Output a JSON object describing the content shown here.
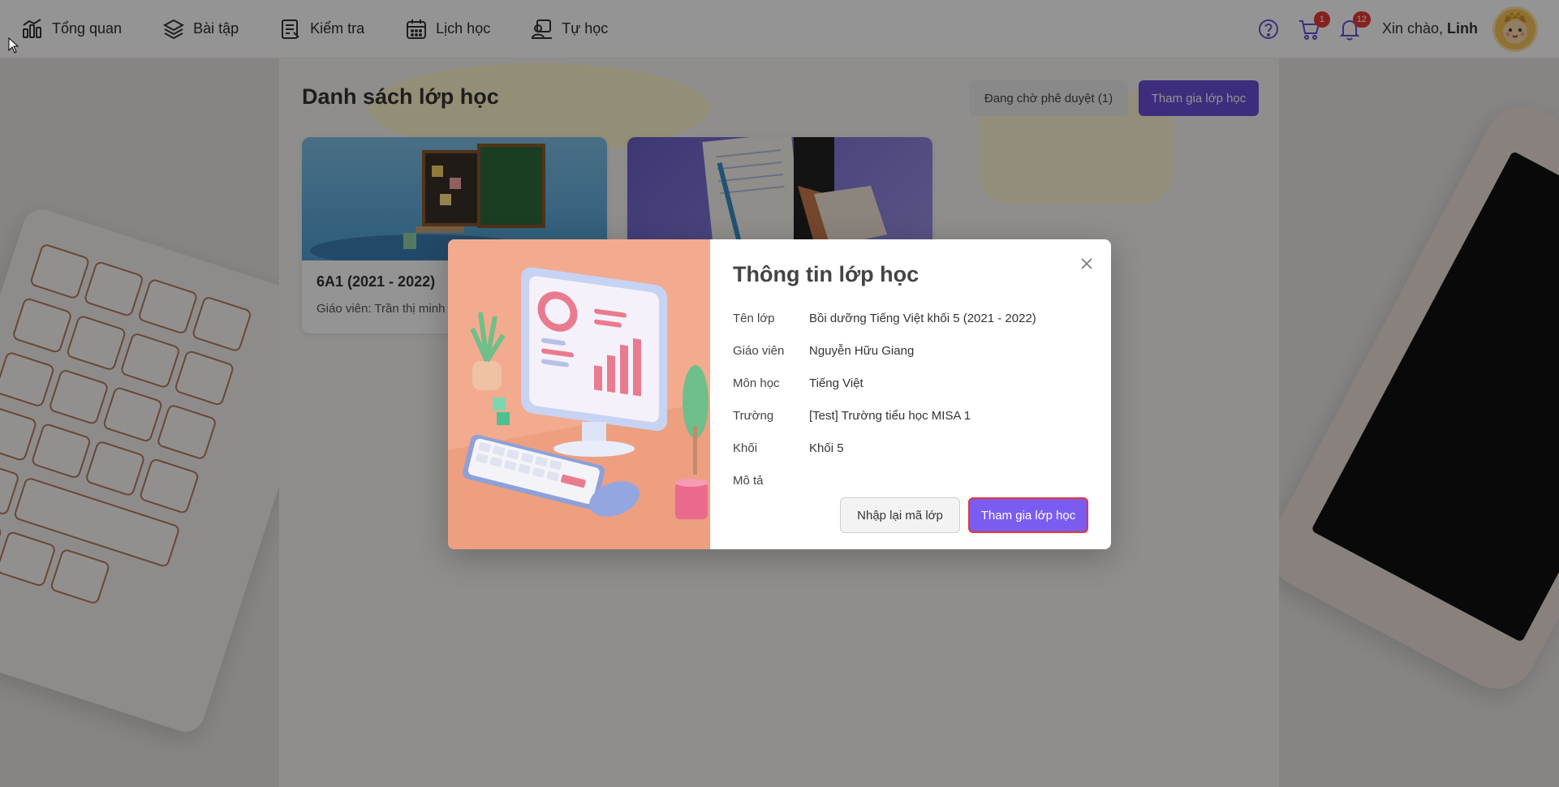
{
  "nav": {
    "items": [
      {
        "label": "Tổng quan",
        "icon": "chart-icon"
      },
      {
        "label": "Bài tập",
        "icon": "layers-icon"
      },
      {
        "label": "Kiểm tra",
        "icon": "test-icon"
      },
      {
        "label": "Lịch học",
        "icon": "calendar-icon"
      },
      {
        "label": "Tự học",
        "icon": "self-study-icon"
      }
    ]
  },
  "header": {
    "cart_count": "1",
    "notification_count": "12",
    "greeting_prefix": "Xin chào, ",
    "user_name": "Linh"
  },
  "main": {
    "title": "Danh sách lớp học",
    "pending_button": "Đang chờ phê duyệt (1)",
    "join_button": "Tham gia lớp học",
    "cards": [
      {
        "title": "6A1 (2021 - 2022)",
        "teacher": "Giáo viên: Trần thị minh"
      },
      {
        "title": "",
        "teacher": ""
      }
    ]
  },
  "modal": {
    "title": "Thông tin lớp học",
    "rows": [
      {
        "label": "Tên lớp",
        "value": "Bồi dưỡng Tiếng Việt khối 5 (2021 - 2022)"
      },
      {
        "label": "Giáo viên",
        "value": "Nguyễn Hữu Giang"
      },
      {
        "label": "Môn học",
        "value": "Tiếng Việt"
      },
      {
        "label": "Trường",
        "value": "[Test] Trường tiểu học MISA 1"
      },
      {
        "label": "Khối",
        "value": "Khối 5"
      },
      {
        "label": "Mô tả",
        "value": ""
      }
    ],
    "reenter_button": "Nhập lại mã lớp",
    "join_button": "Tham gia lớp học"
  },
  "colors": {
    "accent": "#7a5cf0",
    "accent_dark": "#6b4fd8",
    "badge": "#e53935"
  }
}
